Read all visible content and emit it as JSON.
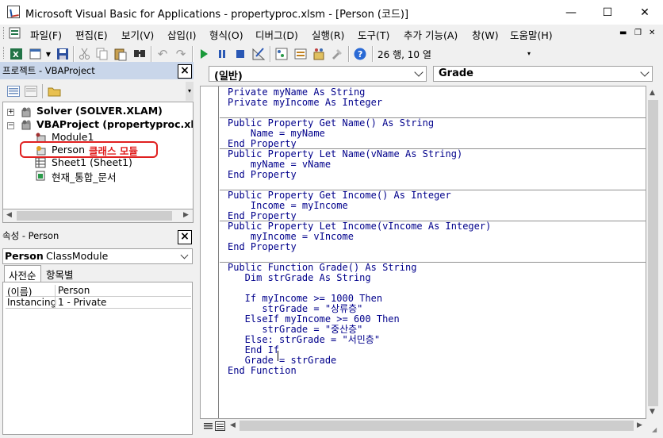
{
  "window": {
    "title": "Microsoft Visual Basic for Applications - propertyproc.xlsm - [Person (코드)]",
    "minimize_glyph": "—",
    "maximize_glyph": "☐",
    "close_glyph": "✕"
  },
  "menu": {
    "items": [
      "파일(F)",
      "편집(E)",
      "보기(V)",
      "삽입(I)",
      "형식(O)",
      "디버그(D)",
      "실행(R)",
      "도구(T)",
      "추가 기능(A)",
      "창(W)",
      "도움말(H)"
    ],
    "mdi_minimize": "▬",
    "mdi_restore": "❐",
    "mdi_close": "✕"
  },
  "toolbar": {
    "position_text": "26 행, 10 열"
  },
  "project": {
    "title": "프로젝트 - VBAProject",
    "tree": [
      {
        "label": "Solver (SOLVER.XLAM)",
        "bold": true
      },
      {
        "label": "VBAProject (propertyproc.xlsm",
        "bold": true
      },
      {
        "label": "Module1",
        "bold": false
      },
      {
        "label": "Person",
        "bold": false
      },
      {
        "label": "Sheet1 (Sheet1)",
        "bold": false
      },
      {
        "label": "현재_통합_문서",
        "bold": false
      }
    ],
    "annotation": "클래스 모듈"
  },
  "properties": {
    "title": "속성 - Person",
    "object_name": "Person",
    "object_type": "ClassModule",
    "tabs": [
      "사전순",
      "항목별"
    ],
    "rows": [
      {
        "key": "(이름)",
        "value": "Person"
      },
      {
        "key": "Instancing",
        "value": "1 - Private"
      }
    ]
  },
  "code": {
    "object_combo": "(일반)",
    "proc_combo": "Grade",
    "lines": [
      "Private myName As String",
      "Private myIncome As Integer",
      "",
      "Public Property Get Name() As String",
      "    Name = myName",
      "End Property",
      "Public Property Let Name(vName As String)",
      "    myName = vName",
      "End Property",
      "",
      "Public Property Get Income() As Integer",
      "    Income = myIncome",
      "End Property",
      "Public Property Let Income(vIncome As Integer)",
      "    myIncome = vIncome",
      "End Property",
      "",
      "Public Function Grade() As String",
      "   Dim strGrade As String",
      "",
      "   If myIncome >= 1000 Then",
      "      strGrade = \"상류층\"",
      "   ElseIf myIncome >= 600 Then",
      "      strGrade = \"중산층\"",
      "   Else: strGrade = \"서민층\"",
      "   End If",
      "   Grade = strGrade",
      "End Function"
    ]
  }
}
